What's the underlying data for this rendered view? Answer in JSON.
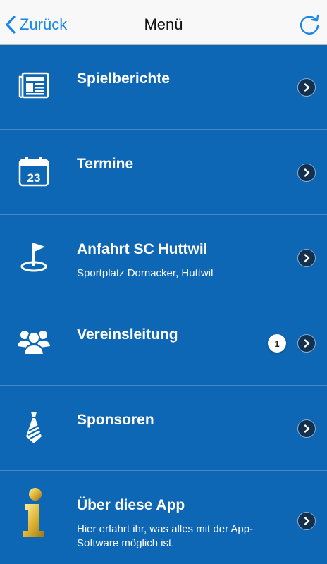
{
  "navbar": {
    "back_label": "Zurück",
    "title": "Menü",
    "refresh_icon": "refresh-icon"
  },
  "menu": {
    "items": [
      {
        "title": "Spielberichte",
        "subtitle": "",
        "icon": "newspaper-icon"
      },
      {
        "title": "Termine",
        "subtitle": "",
        "icon": "calendar-icon",
        "icon_text": "23"
      },
      {
        "title": "Anfahrt SC Huttwil",
        "subtitle": "Sportplatz Dornacker, Huttwil",
        "icon": "location-flag-icon"
      },
      {
        "title": "Vereinsleitung",
        "subtitle": "",
        "icon": "people-icon",
        "badge": "1"
      },
      {
        "title": "Sponsoren",
        "subtitle": "",
        "icon": "tie-icon"
      },
      {
        "title": "Über diese App",
        "subtitle": "Hier erfahrt ihr, was alles mit der App-Software möglich ist.",
        "icon": "info-icon"
      }
    ]
  },
  "colors": {
    "background": "#0d67b5",
    "accent": "#1a86e8",
    "chevron": "#13314f",
    "info_gold": "#d4a72a"
  }
}
